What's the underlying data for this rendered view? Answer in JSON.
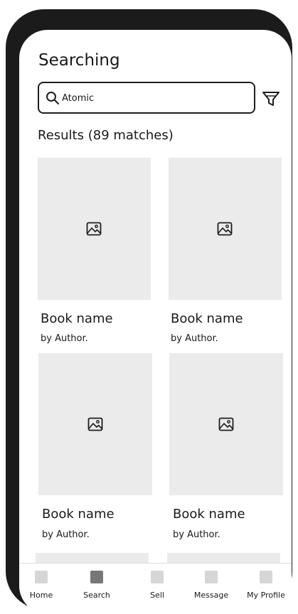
{
  "header": {
    "title": "Searching"
  },
  "search": {
    "value": "Atomic",
    "placeholder": ""
  },
  "results": {
    "label": "Results (89 matches)"
  },
  "books": [
    {
      "name": "Book name",
      "author": "by Author."
    },
    {
      "name": "Book name",
      "author": "by Author."
    },
    {
      "name": "Book name",
      "author": "by Author."
    },
    {
      "name": "Book name",
      "author": "by Author."
    }
  ],
  "nav": {
    "items": [
      {
        "label": "Home",
        "active": false
      },
      {
        "label": "Search",
        "active": true
      },
      {
        "label": "Sell",
        "active": false
      },
      {
        "label": "Message",
        "active": false
      },
      {
        "label": "My Profile",
        "active": false
      }
    ]
  },
  "icons": {
    "search": "search-icon",
    "filter": "filter-icon",
    "image": "image-placeholder-icon"
  },
  "colors": {
    "frame": "#1b1b1b",
    "placeholder": "#ebebeb",
    "nav_active": "#777777",
    "nav_inactive": "#d6d6d6"
  }
}
